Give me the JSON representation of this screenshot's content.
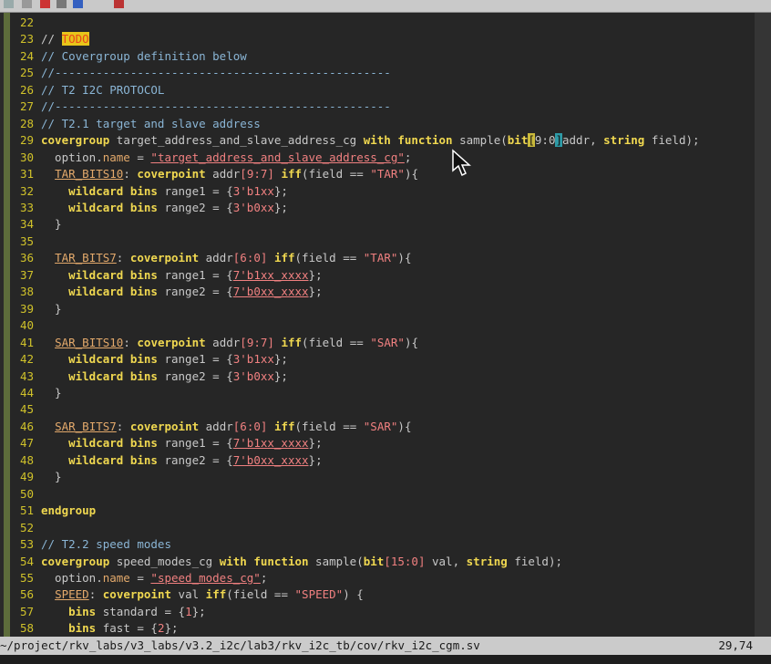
{
  "window": {
    "toolbar_icons": [
      "toolbar-icon-a",
      "toolbar-icon-b",
      "toolbar-icon-c",
      "toolbar-icon-d",
      "toolbar-icon-e",
      "toolbar-icon-f"
    ]
  },
  "editor": {
    "lines": [
      {
        "n": "22"
      },
      {
        "n": "23",
        "t1": "// ",
        "todo": "TODO"
      },
      {
        "n": "24",
        "cm": "// Covergroup definition below"
      },
      {
        "n": "25",
        "cm": "//-------------------------------------------------"
      },
      {
        "n": "26",
        "cm": "// T2 I2C PROTOCOL"
      },
      {
        "n": "27",
        "cm": "//-------------------------------------------------"
      },
      {
        "n": "28",
        "cm": "// T2.1 target and slave address"
      },
      {
        "n": "29",
        "kw1": "covergroup",
        "t1": " target_address_and_slave_address_cg ",
        "kw2": "with function",
        "t2": " sample(",
        "kw3": "bit",
        "pm1": "[",
        "t3": "9:0",
        "pm2": "]",
        "t4": "addr, ",
        "kw4": "string",
        "t5": " field);"
      },
      {
        "n": "30",
        "t1": "  option.",
        "nm": "name",
        "t2": " = ",
        "st": "\"target_address_and_slave_address_cg\"",
        "t3": ";"
      },
      {
        "n": "31",
        "t1": "  ",
        "nm": "TAR_BITS10",
        "t2": ": ",
        "kw1": "coverpoint",
        "t3": " addr",
        "st1": "[9:7]",
        "t4": " ",
        "kw2": "iff",
        "t5": "(field == ",
        "st2": "\"TAR\"",
        "t6": "){"
      },
      {
        "n": "32",
        "t1": "    ",
        "kw1": "wildcard bins",
        "t2": " range1 = {",
        "st": "3'b1xx",
        "t3": "};"
      },
      {
        "n": "33",
        "t1": "    ",
        "kw1": "wildcard bins",
        "t2": " range2 = {",
        "st": "3'b0xx",
        "t3": "};"
      },
      {
        "n": "34",
        "t1": "  }"
      },
      {
        "n": "35"
      },
      {
        "n": "36",
        "t1": "  ",
        "nm": "TAR_BITS7",
        "t2": ": ",
        "kw1": "coverpoint",
        "t3": " addr",
        "st1": "[6:0]",
        "t4": " ",
        "kw2": "iff",
        "t5": "(field == ",
        "st2": "\"TAR\"",
        "t6": "){"
      },
      {
        "n": "37",
        "t1": "    ",
        "kw1": "wildcard bins",
        "t2": " range1 = {",
        "st": "7'b1xx_xxxx",
        "t3": "};"
      },
      {
        "n": "38",
        "t1": "    ",
        "kw1": "wildcard bins",
        "t2": " range2 = {",
        "st": "7'b0xx_xxxx",
        "t3": "};"
      },
      {
        "n": "39",
        "t1": "  }"
      },
      {
        "n": "40"
      },
      {
        "n": "41",
        "t1": "  ",
        "nm": "SAR_BITS10",
        "t2": ": ",
        "kw1": "coverpoint",
        "t3": " addr",
        "st1": "[9:7]",
        "t4": " ",
        "kw2": "iff",
        "t5": "(field == ",
        "st2": "\"SAR\"",
        "t6": "){"
      },
      {
        "n": "42",
        "t1": "    ",
        "kw1": "wildcard bins",
        "t2": " range1 = {",
        "st": "3'b1xx",
        "t3": "};"
      },
      {
        "n": "43",
        "t1": "    ",
        "kw1": "wildcard bins",
        "t2": " range2 = {",
        "st": "3'b0xx",
        "t3": "};"
      },
      {
        "n": "44",
        "t1": "  }"
      },
      {
        "n": "45"
      },
      {
        "n": "46",
        "t1": "  ",
        "nm": "SAR_BITS7",
        "t2": ": ",
        "kw1": "coverpoint",
        "t3": " addr",
        "st1": "[6:0]",
        "t4": " ",
        "kw2": "iff",
        "t5": "(field == ",
        "st2": "\"SAR\"",
        "t6": "){"
      },
      {
        "n": "47",
        "t1": "    ",
        "kw1": "wildcard bins",
        "t2": " range1 = {",
        "st": "7'b1xx_xxxx",
        "t3": "};"
      },
      {
        "n": "48",
        "t1": "    ",
        "kw1": "wildcard bins",
        "t2": " range2 = {",
        "st": "7'b0xx_xxxx",
        "t3": "};"
      },
      {
        "n": "49",
        "t1": "  }"
      },
      {
        "n": "50"
      },
      {
        "n": "51",
        "kw1": "endgroup"
      },
      {
        "n": "52"
      },
      {
        "n": "53",
        "cm": "// T2.2 speed modes"
      },
      {
        "n": "54",
        "kw1": "covergroup",
        "t1": " speed_modes_cg ",
        "kw2": "with function",
        "t2": " sample(",
        "kw3": "bit",
        "st1": "[15:0]",
        "t3": " val, ",
        "kw4": "string",
        "t4": " field);"
      },
      {
        "n": "55",
        "t1": "  option.",
        "nm": "name",
        "t2": " = ",
        "st": "\"speed_modes_cg\"",
        "t3": ";"
      },
      {
        "n": "56",
        "t1": "  ",
        "nm": "SPEED",
        "t2": ": ",
        "kw1": "coverpoint",
        "t3": " val ",
        "kw2": "iff",
        "t4": "(field == ",
        "st2": "\"SPEED\"",
        "t5": ") {"
      },
      {
        "n": "57",
        "t1": "    ",
        "kw1": "bins",
        "t2": " standard = {",
        "st": "1",
        "t3": "};"
      },
      {
        "n": "58",
        "t1": "    ",
        "kw1": "bins",
        "t2": " fast = {",
        "st": "2",
        "t3": "};"
      }
    ]
  },
  "status": {
    "path": "~/project/rkv_labs/v3_labs/v3.2_i2c/lab3/rkv_i2c_tb/cov/rkv_i2c_cgm.sv",
    "position": "29,74"
  }
}
